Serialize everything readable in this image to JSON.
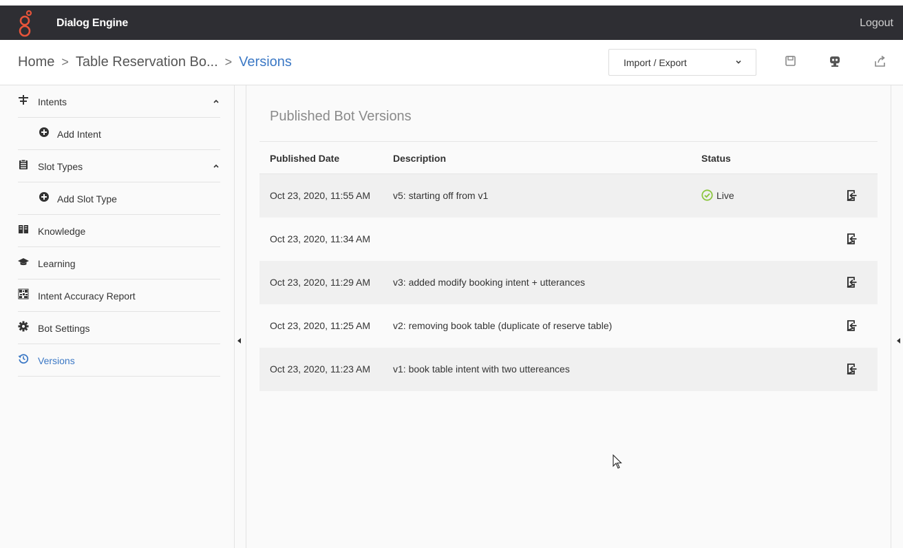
{
  "app": {
    "title": "Dialog Engine",
    "logout_label": "Logout",
    "brand_color": "#e8543a"
  },
  "breadcrumb": {
    "home": "Home",
    "bot": "Table Reservation Bo...",
    "current": "Versions"
  },
  "toolbar": {
    "import_export_label": "Import / Export",
    "icons": [
      "save-icon",
      "bot-test-icon",
      "publish-icon"
    ]
  },
  "sidebar": {
    "items": [
      {
        "label": "Intents",
        "icon": "signpost-icon",
        "expanded": true
      },
      {
        "label": "Add Intent",
        "icon": "plus-circle-icon"
      },
      {
        "label": "Slot Types",
        "icon": "clipboard-icon",
        "expanded": true
      },
      {
        "label": "Add Slot Type",
        "icon": "plus-circle-icon"
      },
      {
        "label": "Knowledge",
        "icon": "book-icon"
      },
      {
        "label": "Learning",
        "icon": "graduation-cap-icon"
      },
      {
        "label": "Intent Accuracy Report",
        "icon": "report-icon"
      },
      {
        "label": "Bot Settings",
        "icon": "gear-icon"
      },
      {
        "label": "Versions",
        "icon": "history-icon",
        "active": true
      }
    ]
  },
  "main": {
    "title": "Published Bot Versions",
    "columns": {
      "date": "Published Date",
      "description": "Description",
      "status": "Status"
    },
    "rows": [
      {
        "date": "Oct 23, 2020, 11:55 AM",
        "description": "v5: starting off from v1",
        "status": "Live"
      },
      {
        "date": "Oct 23, 2020, 11:34 AM",
        "description": "",
        "status": ""
      },
      {
        "date": "Oct 23, 2020, 11:29 AM",
        "description": "v3: added modify booking intent + utterances",
        "status": ""
      },
      {
        "date": "Oct 23, 2020, 11:25 AM",
        "description": "v2: removing book table (duplicate of reserve table)",
        "status": ""
      },
      {
        "date": "Oct 23, 2020, 11:23 AM",
        "description": "v1: book table intent with two uttereances",
        "status": ""
      }
    ],
    "live_color": "#8cc63f"
  }
}
